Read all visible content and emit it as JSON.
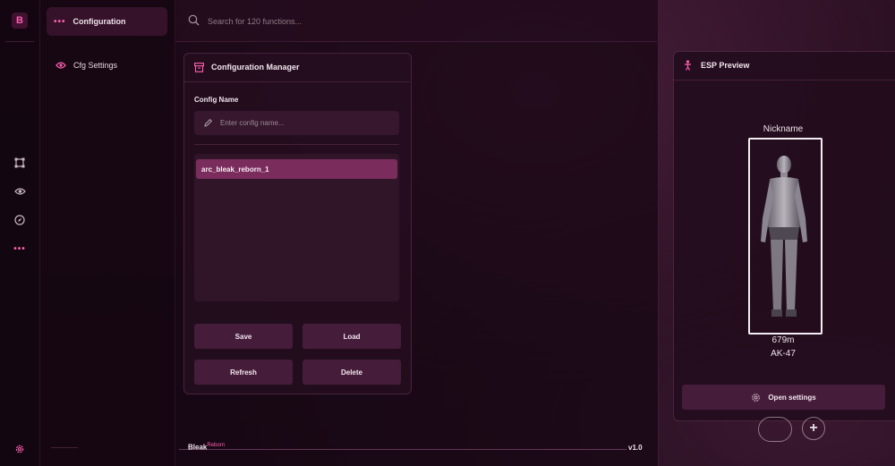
{
  "sidebar": {
    "logo_letter": "B",
    "icons": [
      "selection-icon",
      "eye-icon",
      "compass-icon",
      "more-dots-icon"
    ],
    "footer_icon": "gear-icon"
  },
  "category_tab": {
    "label": "Configuration"
  },
  "subnav": {
    "items": [
      {
        "label": "Cfg Settings"
      }
    ]
  },
  "search": {
    "placeholder": "Search for 120 functions..."
  },
  "config_manager": {
    "title": "Configuration Manager",
    "config_name_label": "Config Name",
    "config_name_placeholder": "Enter config name...",
    "configs": [
      "arc_bleak_reborn_1"
    ],
    "buttons": {
      "save": "Save",
      "load": "Load",
      "refresh": "Refresh",
      "delete": "Delete"
    }
  },
  "footer": {
    "brand": "Bleak",
    "brand_sub": "Reborn",
    "version": "v1.0"
  },
  "esp_preview": {
    "title": "ESP Preview",
    "nickname": "Nickname",
    "distance": "679m",
    "weapon": "AK-47",
    "open_settings_label": "Open settings"
  },
  "colors": {
    "accent": "#ff5fb2",
    "selected_item": "#7a2c5c",
    "button": "#48203c"
  }
}
